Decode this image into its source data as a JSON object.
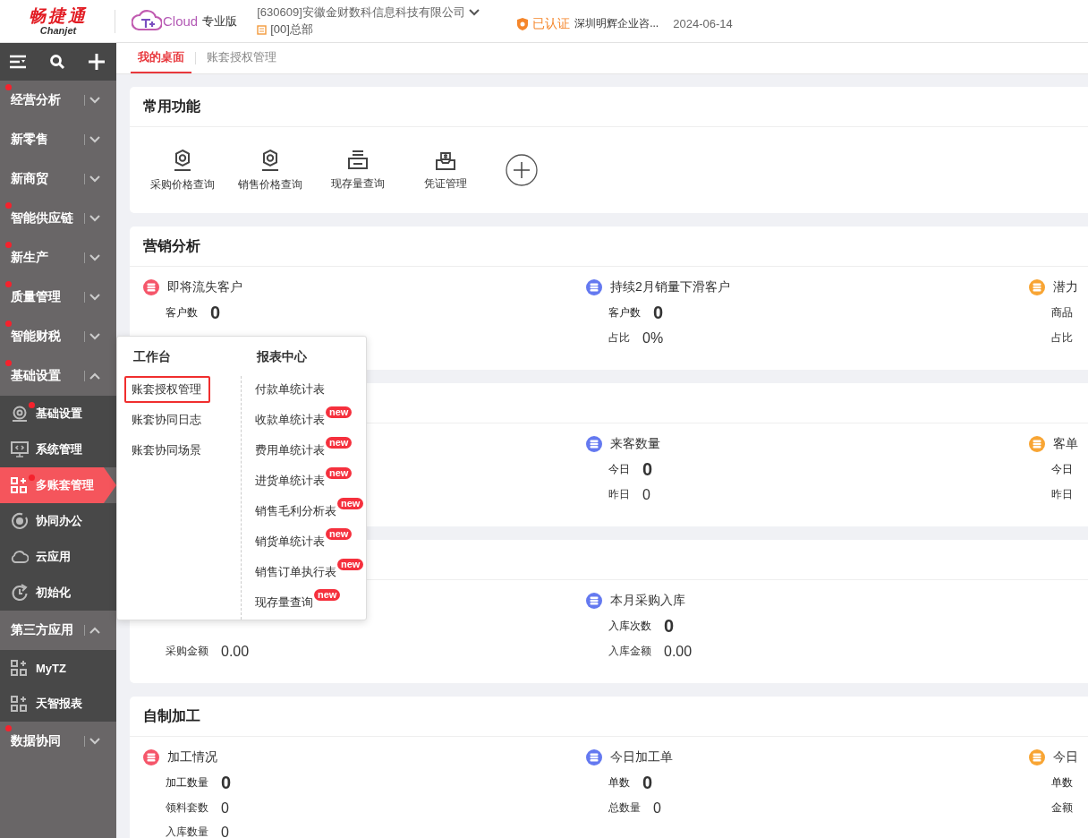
{
  "header": {
    "logo": "畅捷通",
    "logo_sub": "Chanjet",
    "product": "Cloud",
    "edition": "专业版",
    "company": "[630609]安徽金财数科信息科技有限公司",
    "branch": "[00]总部",
    "cert": "已认证",
    "cert_company": "深圳明辉企业咨...",
    "date": "2024-06-14"
  },
  "sidebar": {
    "groups": [
      {
        "label": "经营分析",
        "dot": true,
        "expanded": false
      },
      {
        "label": "新零售",
        "dot": false,
        "expanded": false
      },
      {
        "label": "新商贸",
        "dot": false,
        "expanded": false
      },
      {
        "label": "智能供应链",
        "dot": true,
        "expanded": false
      },
      {
        "label": "新生产",
        "dot": true,
        "expanded": false
      },
      {
        "label": "质量管理",
        "dot": true,
        "expanded": false
      },
      {
        "label": "智能财税",
        "dot": true,
        "expanded": false
      },
      {
        "label": "基础设置",
        "dot": true,
        "expanded": true,
        "children": [
          {
            "label": "基础设置",
            "kind": "gear",
            "dot": true,
            "selected": false
          },
          {
            "label": "系统管理",
            "kind": "monitor",
            "dot": false,
            "selected": false
          },
          {
            "label": "多账套管理",
            "kind": "grid",
            "dot": true,
            "selected": true
          },
          {
            "label": "协同办公",
            "kind": "target",
            "dot": false,
            "selected": false
          },
          {
            "label": "云应用",
            "kind": "cloud",
            "dot": false,
            "selected": false
          },
          {
            "label": "初始化",
            "kind": "refresh",
            "dot": false,
            "selected": false
          }
        ]
      },
      {
        "label": "第三方应用",
        "dot": false,
        "expanded": true,
        "children": [
          {
            "label": "MyTZ",
            "kind": "grid",
            "dot": false,
            "selected": false
          },
          {
            "label": "天智报表",
            "kind": "grid",
            "dot": false,
            "selected": false
          }
        ]
      },
      {
        "label": "数据协同",
        "dot": true,
        "expanded": false
      }
    ]
  },
  "tabs": [
    {
      "label": "我的桌面",
      "selected": true
    },
    {
      "label": "账套授权管理",
      "selected": false
    }
  ],
  "quick": {
    "title": "常用功能",
    "items": [
      {
        "label": "采购价格查询",
        "kind": "gear"
      },
      {
        "label": "销售价格查询",
        "kind": "gear"
      },
      {
        "label": "现存量查询",
        "kind": "printer"
      },
      {
        "label": "凭证管理",
        "kind": "voucher"
      }
    ]
  },
  "sections": [
    {
      "title": "营销分析",
      "left": {
        "title": "即将流失客户",
        "color": "#f5566a",
        "rows": [
          {
            "label": "客户数",
            "value": "0",
            "kind": "main"
          }
        ]
      },
      "middle": {
        "title": "持续2月销量下滑客户",
        "color": "#6479f0",
        "rows": [
          {
            "label": "客户数",
            "value": "0",
            "kind": "main"
          },
          {
            "label": "占比",
            "value": "0%",
            "kind": "sub"
          }
        ]
      },
      "right": {
        "title": "潜力",
        "color": "#f8a534",
        "rows": [
          {
            "label": "商品",
            "kind": "main"
          },
          {
            "label": "占比",
            "kind": "sub"
          }
        ]
      }
    },
    {
      "middle": {
        "title": "来客数量",
        "color": "#6479f0",
        "rows": [
          {
            "label": "今日",
            "value": "0",
            "kind": "main"
          },
          {
            "label": "昨日",
            "value": "0",
            "kind": "sub"
          }
        ]
      },
      "right": {
        "title": "客单",
        "color": "#f8a534",
        "rows": [
          {
            "label": "今日",
            "kind": "main"
          },
          {
            "label": "昨日",
            "kind": "sub"
          }
        ]
      }
    },
    {
      "left": {
        "rows": [
          {
            "label": "采购金额",
            "value": "0.00",
            "kind": "sub"
          }
        ]
      },
      "middle": {
        "title": "本月采购入库",
        "color": "#6479f0",
        "rows": [
          {
            "label": "入库次数",
            "value": "0",
            "kind": "main"
          },
          {
            "label": "入库金额",
            "value": "0.00",
            "kind": "sub"
          }
        ]
      }
    },
    {
      "title": "自制加工",
      "left": {
        "title": "加工情况",
        "color": "#f5566a",
        "rows": [
          {
            "label": "加工数量",
            "value": "0",
            "kind": "main"
          },
          {
            "label": "领料套数",
            "value": "0",
            "kind": "sub"
          },
          {
            "label": "入库数量",
            "value": "0",
            "kind": "sub"
          }
        ]
      },
      "middle": {
        "title": "今日加工单",
        "color": "#6479f0",
        "rows": [
          {
            "label": "单数",
            "value": "0",
            "kind": "main"
          },
          {
            "label": "总数量",
            "value": "0",
            "kind": "sub"
          }
        ]
      },
      "right": {
        "title": "今日",
        "color": "#f8a534",
        "rows": [
          {
            "label": "单数",
            "kind": "main"
          },
          {
            "label": "金额",
            "kind": "sub"
          }
        ]
      }
    }
  ],
  "popup": {
    "columns": [
      {
        "title": "工作台",
        "items": [
          {
            "label": "账套授权管理",
            "highlighted": true
          },
          {
            "label": "账套协同日志",
            "highlighted": false
          },
          {
            "label": "账套协同场景",
            "highlighted": false
          }
        ]
      },
      {
        "title": "报表中心",
        "items": [
          {
            "label": "付款单统计表"
          },
          {
            "label": "收款单统计表",
            "badge": "new"
          },
          {
            "label": "费用单统计表",
            "badge": "new"
          },
          {
            "label": "进货单统计表",
            "badge": "new"
          },
          {
            "label": "销售毛利分析表",
            "badge": "new"
          },
          {
            "label": "销货单统计表",
            "badge": "new"
          },
          {
            "label": "销售订单执行表",
            "badge": "new"
          },
          {
            "label": "现存量查询",
            "badge": "new"
          }
        ]
      }
    ]
  }
}
